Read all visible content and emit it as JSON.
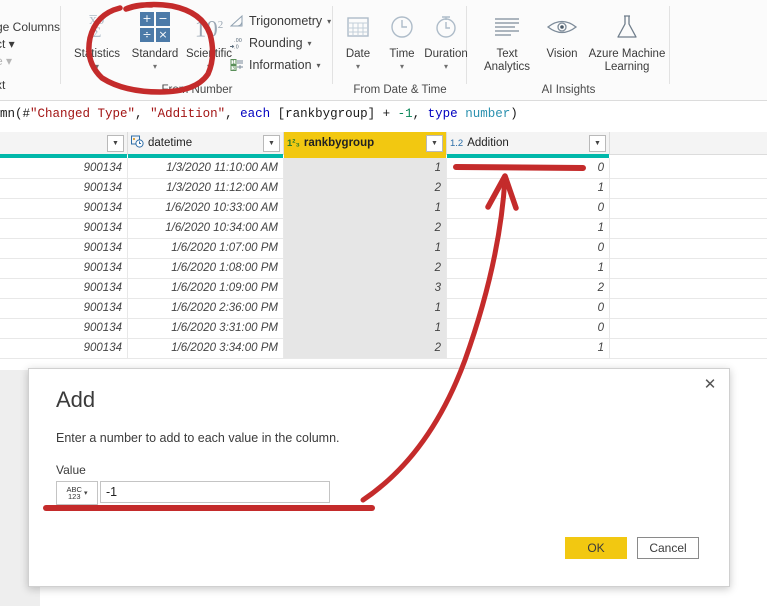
{
  "ribbon": {
    "clipped_left": [
      {
        "text": "ge Columns",
        "name": "manage-columns-clipped"
      },
      {
        "text": "ct ▾",
        "name": "select-columns-clipped"
      },
      {
        "text": "e ▾",
        "name": "remove-columns-clipped"
      },
      {
        "text": "xt",
        "name": "from-text-group-clipped"
      }
    ],
    "groups": [
      {
        "label": "From Number",
        "buttons": [
          {
            "label": "Statistics",
            "icon": "statistics-icon",
            "caret": "▾"
          },
          {
            "label": "Standard",
            "icon": "standard-operations-icon",
            "caret": "▾"
          },
          {
            "label": "Scientific",
            "icon": "scientific-icon",
            "caret": "▾"
          }
        ],
        "small_buttons": [
          {
            "label": "Trigonometry",
            "icon": "trigonometry-icon",
            "caret": "▾"
          },
          {
            "label": "Rounding",
            "icon": "rounding-icon",
            "caret": "▾"
          },
          {
            "label": "Information",
            "icon": "information-icon",
            "caret": "▾"
          }
        ]
      },
      {
        "label": "From Date & Time",
        "buttons": [
          {
            "label": "Date",
            "icon": "calendar-icon",
            "caret": "▾"
          },
          {
            "label": "Time",
            "icon": "clock-icon",
            "caret": "▾"
          },
          {
            "label": "Duration",
            "icon": "stopwatch-icon",
            "caret": "▾"
          }
        ],
        "small_buttons": []
      },
      {
        "label": "AI Insights",
        "buttons": [
          {
            "label": "Text Analytics",
            "icon": "text-analytics-icon",
            "caret": ""
          },
          {
            "label": "Vision",
            "icon": "eye-icon",
            "caret": ""
          },
          {
            "label": "Azure Machine Learning",
            "icon": "flask-icon",
            "caret": ""
          }
        ],
        "small_buttons": []
      }
    ],
    "standard_icon_ops": [
      "+",
      "−",
      "÷",
      "×"
    ],
    "scientific_base": "10",
    "scientific_exp": "2"
  },
  "formula": {
    "segments": [
      {
        "text": "mn(#",
        "style": "plain"
      },
      {
        "text": "\"Changed Type\"",
        "style": "str"
      },
      {
        "text": ", ",
        "style": "plain"
      },
      {
        "text": "\"Addition\"",
        "style": "str"
      },
      {
        "text": ", ",
        "style": "plain"
      },
      {
        "text": "each",
        "style": "kw"
      },
      {
        "text": " [rankbygroup] + ",
        "style": "plain"
      },
      {
        "text": "-1",
        "style": "num"
      },
      {
        "text": ", ",
        "style": "plain"
      },
      {
        "text": "type",
        "style": "kw"
      },
      {
        "text": " ",
        "style": "plain"
      },
      {
        "text": "number",
        "style": "type"
      },
      {
        "text": ")",
        "style": "plain"
      }
    ]
  },
  "grid": {
    "columns": [
      {
        "name": "",
        "type_icon": "",
        "selected": false,
        "quality": "teal"
      },
      {
        "name": "datetime",
        "type_icon": "datetime-type-icon",
        "selected": false,
        "quality": "teal"
      },
      {
        "name": "rankbygroup",
        "type_icon": "1²₃",
        "selected": true,
        "quality": "gold"
      },
      {
        "name": "Addition",
        "type_icon": "1.2",
        "selected": false,
        "quality": "teal"
      }
    ],
    "rows": [
      {
        "id": "900134",
        "datetime": "1/3/2020 11:10:00 AM",
        "rankbygroup": "1",
        "addition": "0"
      },
      {
        "id": "900134",
        "datetime": "1/3/2020 11:12:00 AM",
        "rankbygroup": "2",
        "addition": "1"
      },
      {
        "id": "900134",
        "datetime": "1/6/2020 10:33:00 AM",
        "rankbygroup": "1",
        "addition": "0"
      },
      {
        "id": "900134",
        "datetime": "1/6/2020 10:34:00 AM",
        "rankbygroup": "2",
        "addition": "1"
      },
      {
        "id": "900134",
        "datetime": "1/6/2020 1:07:00 PM",
        "rankbygroup": "1",
        "addition": "0"
      },
      {
        "id": "900134",
        "datetime": "1/6/2020 1:08:00 PM",
        "rankbygroup": "2",
        "addition": "1"
      },
      {
        "id": "900134",
        "datetime": "1/6/2020 1:09:00 PM",
        "rankbygroup": "3",
        "addition": "2"
      },
      {
        "id": "900134",
        "datetime": "1/6/2020 2:36:00 PM",
        "rankbygroup": "1",
        "addition": "0"
      },
      {
        "id": "900134",
        "datetime": "1/6/2020 3:31:00 PM",
        "rankbygroup": "1",
        "addition": "0"
      },
      {
        "id": "900134",
        "datetime": "1/6/2020 3:34:00 PM",
        "rankbygroup": "2",
        "addition": "1"
      }
    ]
  },
  "dialog": {
    "title": "Add",
    "description": "Enter a number to add to each value in the column.",
    "value_label": "Value",
    "value": "-1",
    "value_placeholder": "",
    "type_selector": {
      "line1": "ABC",
      "line2": "123",
      "caret": "▾"
    },
    "ok_label": "OK",
    "cancel_label": "Cancel",
    "close_icon": "✕"
  },
  "colors": {
    "accent_gold": "#F2C811",
    "quality_teal": "#01B8AA",
    "annotation_red": "#C42B2B",
    "icon_blue": "#4C7AA8"
  }
}
